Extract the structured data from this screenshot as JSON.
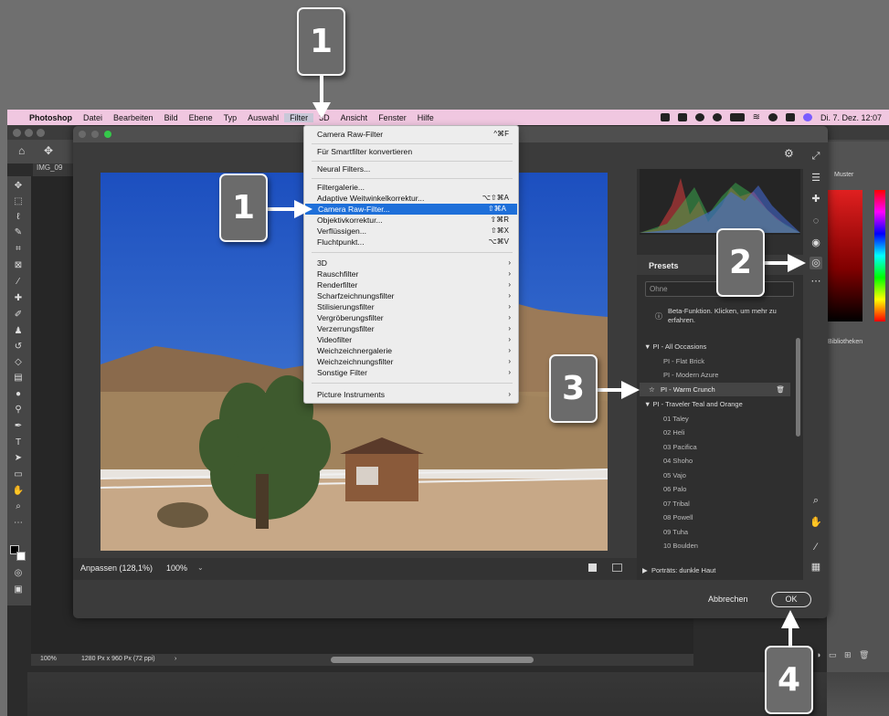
{
  "menubar": {
    "app": "Photoshop",
    "items": [
      "Datei",
      "Bearbeiten",
      "Bild",
      "Ebene",
      "Typ",
      "Auswahl",
      "Filter",
      "3D",
      "Ansicht",
      "Fenster",
      "Hilfe"
    ],
    "datetime": "Di. 7. Dez.  12:07"
  },
  "photoshop": {
    "doc_tab": "IMG_09",
    "status_zoom": "100%",
    "status_info": "1280 Px x 960 Px (72 ppi)",
    "panel_swatches": "Muster",
    "panel_libraries": "Bibliotheken"
  },
  "filter_menu": {
    "top": {
      "label": "Camera Raw-Filter",
      "shortcut": "^⌘F"
    },
    "smart": "Für Smartfilter konvertieren",
    "neural": "Neural Filters...",
    "group1": [
      {
        "label": "Filtergalerie...",
        "shortcut": ""
      },
      {
        "label": "Adaptive Weitwinkelkorrektur...",
        "shortcut": "⌥⇧⌘A"
      },
      {
        "label": "Camera Raw-Filter...",
        "shortcut": "⇧⌘A"
      },
      {
        "label": "Objektivkorrektur...",
        "shortcut": "⇧⌘R"
      },
      {
        "label": "Verflüssigen...",
        "shortcut": "⇧⌘X"
      },
      {
        "label": "Fluchtpunkt...",
        "shortcut": "⌥⌘V"
      }
    ],
    "submenus": [
      "3D",
      "Rauschfilter",
      "Renderfilter",
      "Scharfzeichnungsfilter",
      "Stilisierungsfilter",
      "Vergröberungsfilter",
      "Verzerrungsfilter",
      "Videofilter",
      "Weichzeichnergalerie",
      "Weichzeichnungsfilter",
      "Sonstige Filter"
    ],
    "plugin": "Picture Instruments"
  },
  "camera_raw": {
    "zoom_label": "Anpassen (128,1%)",
    "zoom_pct": "100%",
    "presets_title": "Presets",
    "preset_search": "Ohne",
    "beta_text": "Beta-Funktion. Klicken, um mehr zu erfahren.",
    "preset_groups": [
      {
        "label": "PI - All Occasions",
        "items": [
          "PI - Flat Brick",
          "PI - Modern Azure",
          "PI - Warm Crunch"
        ]
      },
      {
        "label": "PI - Traveler Teal and Orange",
        "items": [
          "01 Taley",
          "02 Heli",
          "03 Pacifica",
          "04 Shoho",
          "05 Vajo",
          "06 Palo",
          "07 Tribal",
          "08 Powell",
          "09 Tuha",
          "10 Boulden"
        ]
      }
    ],
    "selected_preset": "PI - Warm Crunch",
    "collapsed_group": "Porträts: dunkle Haut",
    "cancel_label": "Abbrechen",
    "ok_label": "OK"
  },
  "callouts": [
    "1",
    "1",
    "2",
    "3",
    "4"
  ],
  "colors": {
    "menubar_bg": "#f0c7e0",
    "menu_highlight": "#1e6fd9",
    "badge_bg": "#6b6b6b"
  }
}
